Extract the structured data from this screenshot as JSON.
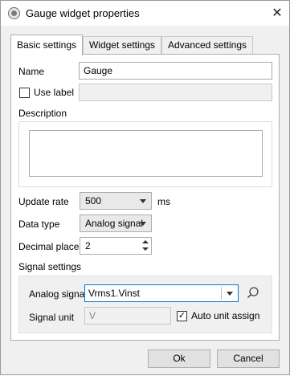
{
  "window": {
    "title": "Gauge widget properties",
    "close_glyph": "✕"
  },
  "tabs": [
    {
      "label": "Basic settings",
      "active": true
    },
    {
      "label": "Widget settings",
      "active": false
    },
    {
      "label": "Advanced settings",
      "active": false
    }
  ],
  "basic": {
    "name_label": "Name",
    "name_value": "Gauge",
    "use_label_label": "Use label",
    "use_label_checked": false,
    "description_label": "Description",
    "description_value": "",
    "update_rate_label": "Update rate",
    "update_rate_value": "500",
    "update_rate_unit": "ms",
    "data_type_label": "Data type",
    "data_type_value": "Analog signal",
    "decimal_places_label": "Decimal places",
    "decimal_places_value": "2",
    "signal_settings_label": "Signal settings",
    "analog_signal_label": "Analog signal",
    "analog_signal_value": "Vrms1.Vinst",
    "signal_unit_label": "Signal unit",
    "signal_unit_value": "V",
    "auto_unit_label": "Auto unit assign",
    "auto_unit_checked": true,
    "check_glyph": "✓"
  },
  "buttons": {
    "ok": "Ok",
    "cancel": "Cancel"
  },
  "icons": {
    "app": "gauge-app-icon",
    "close": "close-icon",
    "search": "search-icon",
    "dropdown": "chevron-down-icon",
    "spin_up": "spin-up-icon",
    "spin_down": "spin-down-icon"
  }
}
